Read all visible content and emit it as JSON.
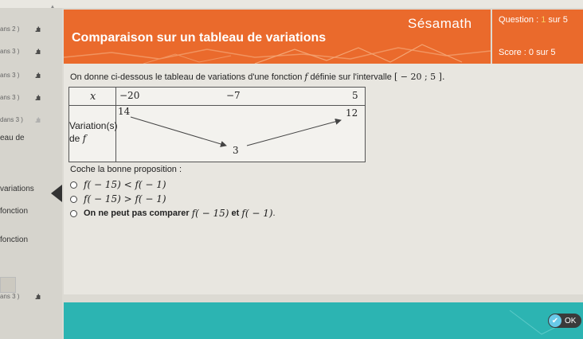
{
  "sidebar": {
    "rows": [
      {
        "label": "ans 2 )",
        "bars": ".ılı"
      },
      {
        "label": "ans 3 )",
        "bars": ".ılı"
      },
      {
        "label": "ans 3 )",
        "bars": ".ılı"
      },
      {
        "label": "ans 3 )",
        "bars": ".ılı"
      },
      {
        "label": "dans 3 )",
        "bars": ".ılı"
      }
    ],
    "texts": [
      "eau de",
      "variations",
      "fonction",
      "fonction"
    ],
    "bottom_row": {
      "label": "ans 3 )",
      "bars": ".ılı"
    }
  },
  "header": {
    "title": "Comparaison sur un tableau de variations",
    "brand": "Sésamath"
  },
  "status": {
    "question_prefix": "Question : ",
    "question_current": "1",
    "question_suffix": " sur 5",
    "score": "Score : 0 sur 5"
  },
  "exercise": {
    "prompt_start": "On donne ci-dessous le tableau de variations d'une fonction ",
    "prompt_f": "f",
    "prompt_mid": " définie sur l'intervalle ",
    "prompt_interval": "[ − 20 ; 5 ].",
    "table": {
      "x_label": "x",
      "x_values": [
        "−20",
        "−7",
        "5"
      ],
      "row_label_1": "Variation(s)",
      "row_label_2": "de ",
      "row_label_f": "f",
      "values": [
        "14",
        "3",
        "12"
      ]
    },
    "instruction": "Coche la bonne proposition :",
    "options": [
      {
        "math": "f( − 15) < f( − 1)"
      },
      {
        "math": "f( − 15) > f( − 1)"
      },
      {
        "text_a": "On ne peut pas comparer ",
        "math_a": "f( − 15)",
        "text_b": " et ",
        "math_b": "f( − 1)",
        "text_c": "."
      }
    ]
  },
  "ok_button": {
    "label": "OK",
    "icon": "check-icon"
  },
  "colors": {
    "accent": "#ea6a2c",
    "bottom": "#2cb4b2"
  }
}
